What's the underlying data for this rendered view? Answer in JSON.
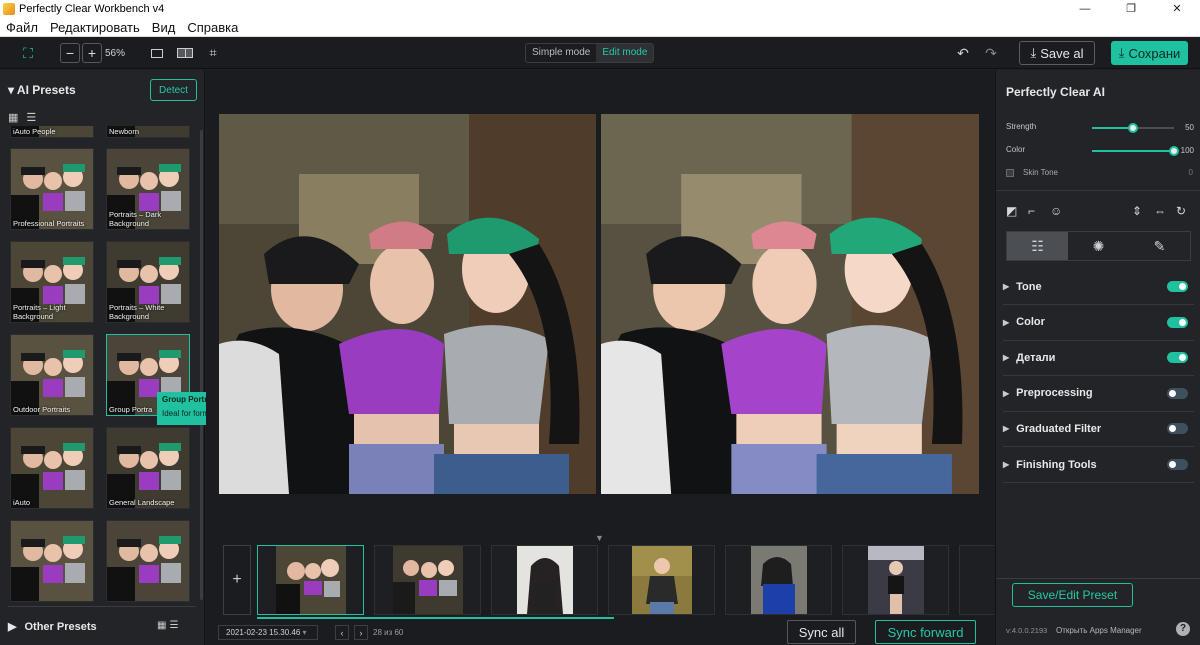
{
  "window": {
    "title": "Perfectly Clear Workbench v4",
    "controls": [
      "—",
      "❐",
      "✕"
    ]
  },
  "menu": [
    "Файл",
    "Редактировать",
    "Вид",
    "Справка"
  ],
  "toolbar": {
    "zoom": "56%",
    "mode_simple": "Simple mode",
    "mode_edit": "Edit mode",
    "save_all": "Save al",
    "save": "Сохрани"
  },
  "left_panel": {
    "title": "AI Presets",
    "detect": "Detect",
    "presets": [
      "iAuto People",
      "Newborn",
      "Professional Portraits",
      "Portraits – Dark Background",
      "Portraits – Light Background",
      "Portraits – White Background",
      "Outdoor Portraits",
      "Group Portra",
      "iAuto",
      "General Landscape",
      "",
      ""
    ],
    "tooltip": {
      "title": "Group Portraits",
      "text": "Ideal for formally posed groups."
    },
    "other_presets": "Other Presets"
  },
  "filmstrip": {
    "date": "2021-02-23 15.30.46",
    "count": "28 из 60",
    "sync_all": "Sync all",
    "sync_forward": "Sync forward"
  },
  "right_panel": {
    "title": "Perfectly Clear AI",
    "strength_label": "Strength",
    "strength": 50,
    "color_label": "Color",
    "color": 100,
    "skin_tone_label": "Skin Tone",
    "skin_tone": 0,
    "sections": [
      {
        "label": "Tone",
        "on": true
      },
      {
        "label": "Color",
        "on": true
      },
      {
        "label": "Детали",
        "on": true
      },
      {
        "label": "Preprocessing",
        "on": false
      },
      {
        "label": "Graduated Filter",
        "on": false
      },
      {
        "label": "Finishing Tools",
        "on": false
      }
    ],
    "save_preset": "Save/Edit Preset",
    "version": "v:4.0.0.2193",
    "apps_manager": "Открыть Apps Manager"
  },
  "colors": {
    "accent": "#1fc1a0",
    "panel": "#232427",
    "bg": "#1b1c1f"
  }
}
